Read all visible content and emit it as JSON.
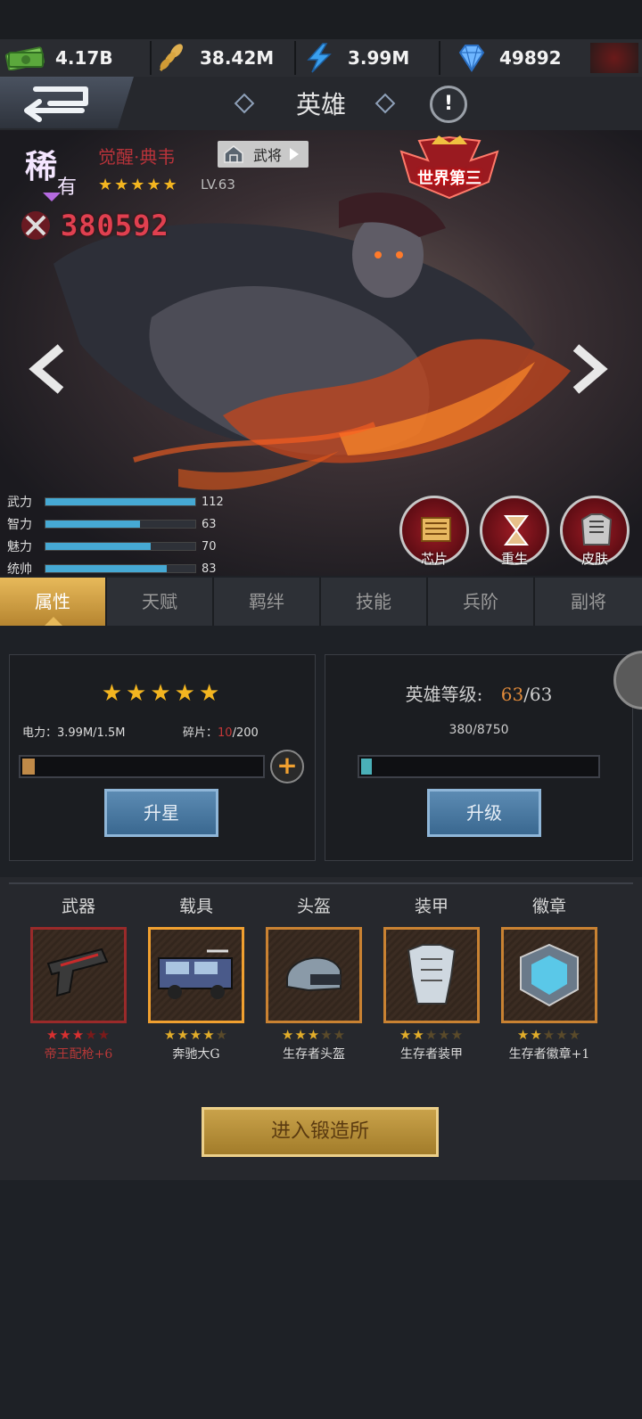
{
  "resources": [
    {
      "icon": "cash-icon",
      "value": "4.17B"
    },
    {
      "icon": "wheat-icon",
      "value": "38.42M"
    },
    {
      "icon": "lightning-icon",
      "value": "3.99M"
    },
    {
      "icon": "diamond-gem-icon",
      "value": "49892"
    }
  ],
  "header": {
    "title": "英雄"
  },
  "hero": {
    "rarity_1": "稀",
    "rarity_2": "有",
    "name": "觉醒·典韦",
    "class_label": "武将",
    "stars": "★★★★★",
    "level": "LV.63",
    "power": "380592",
    "rank_badge": "世界第三"
  },
  "stats": [
    {
      "label": "武力",
      "value": "112",
      "fraction": 1.0
    },
    {
      "label": "智力",
      "value": "63",
      "fraction": 0.63
    },
    {
      "label": "魅力",
      "value": "70",
      "fraction": 0.7
    },
    {
      "label": "统帅",
      "value": "83",
      "fraction": 0.81
    }
  ],
  "actions": [
    {
      "label": "芯片",
      "icon": "chip-icon"
    },
    {
      "label": "重生",
      "icon": "hourglass-icon"
    },
    {
      "label": "皮肤",
      "icon": "armor-icon"
    }
  ],
  "tabs": [
    "属性",
    "天赋",
    "羁绊",
    "技能",
    "兵阶",
    "副将"
  ],
  "star_panel": {
    "stars": "★★★★★",
    "power_text": "电力：3.99M/1.5M",
    "shard_label": "碎片：",
    "shard_current": "10",
    "shard_total": "/200",
    "progress": 0.05,
    "button": "升星"
  },
  "level_panel": {
    "label": "英雄等级:",
    "level_current": "63",
    "level_max": "/63",
    "exp_text": "380/8750",
    "progress": 0.043,
    "button": "升级"
  },
  "equipment": [
    {
      "slot": "武器",
      "name": "帝王配枪+6",
      "stars": 3,
      "max": 5,
      "star_color": "#d83030",
      "name_color": "#b83838",
      "frame": "#9a2a2a",
      "icon": "gun-icon"
    },
    {
      "slot": "载具",
      "name": "奔驰大G",
      "stars": 4,
      "max": 5,
      "star_color": "#e2ad2a",
      "name_color": "#dcdcdc",
      "frame": "#f0a030",
      "icon": "truck-icon"
    },
    {
      "slot": "头盔",
      "name": "生存者头盔",
      "stars": 3,
      "max": 5,
      "star_color": "#e2ad2a",
      "name_color": "#dcdcdc",
      "frame": "#c98232",
      "icon": "helmet-icon"
    },
    {
      "slot": "装甲",
      "name": "生存者装甲",
      "stars": 2,
      "max": 5,
      "star_color": "#e2ad2a",
      "name_color": "#dcdcdc",
      "frame": "#c98232",
      "icon": "armor-vest-icon"
    },
    {
      "slot": "徽章",
      "name": "生存者徽章+1",
      "stars": 2,
      "max": 5,
      "star_color": "#e2ad2a",
      "name_color": "#dcdcdc",
      "frame": "#c98232",
      "icon": "badge-icon"
    }
  ],
  "forge_button": "进入锻造所"
}
